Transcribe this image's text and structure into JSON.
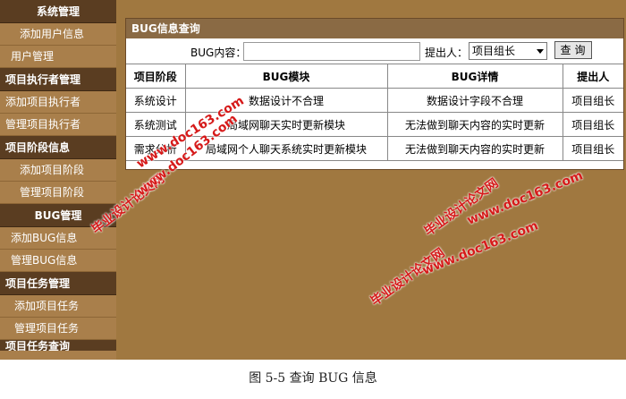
{
  "sidebar": {
    "items": [
      {
        "kind": "head",
        "label": "系统管理"
      },
      {
        "kind": "item",
        "label": "添加用户信息"
      },
      {
        "kind": "item",
        "label": "用户管理"
      },
      {
        "kind": "head",
        "label": "项目执行者管理"
      },
      {
        "kind": "item",
        "label": "添加项目执行者"
      },
      {
        "kind": "item",
        "label": "管理项目执行者"
      },
      {
        "kind": "head",
        "label": "项目阶段信息"
      },
      {
        "kind": "item",
        "label": "添加项目阶段"
      },
      {
        "kind": "item",
        "label": "管理项目阶段"
      },
      {
        "kind": "head",
        "label": "BUG管理"
      },
      {
        "kind": "item",
        "label": "添加BUG信息"
      },
      {
        "kind": "item",
        "label": "管理BUG信息"
      },
      {
        "kind": "head",
        "label": "项目任务管理"
      },
      {
        "kind": "item",
        "label": "添加项目任务"
      },
      {
        "kind": "item",
        "label": "管理项目任务"
      },
      {
        "kind": "head",
        "label": "项目任务查询"
      }
    ]
  },
  "panel": {
    "title": "BUG信息查询",
    "search": {
      "bug_label": "BUG内容：",
      "bug_value": "",
      "submitter_label": "提出人：",
      "submitter_value": "项目组长",
      "button_label": "查询"
    },
    "table": {
      "columns": [
        "项目阶段",
        "BUG模块",
        "BUG详情",
        "提出人"
      ],
      "rows": [
        [
          "系统设计",
          "数据设计不合理",
          "数据设计字段不合理",
          "项目组长"
        ],
        [
          "系统测试",
          "局域网聊天实时更新模块",
          "无法做到聊天内容的实时更新",
          "项目组长"
        ],
        [
          "需求分析",
          "局域网个人聊天系统实时更新模块",
          "无法做到聊天内容的实时更新",
          "项目组长"
        ]
      ]
    }
  },
  "watermarks": [
    "www.doc163.com",
    "毕业设计论文网",
    "www.doc163.com",
    "毕业设计论文网",
    "www.doc163.com",
    "毕业设计论文网",
    "www.doc163.com"
  ],
  "caption": "图 5-5 查询 BUG 信息"
}
